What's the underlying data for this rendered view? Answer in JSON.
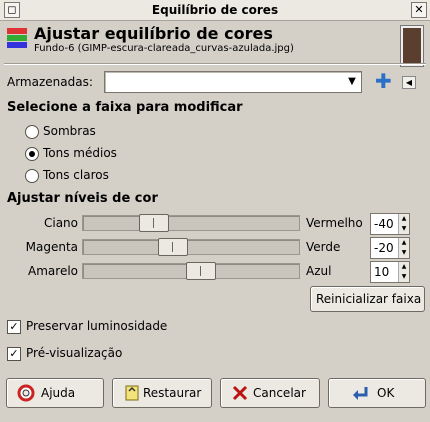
{
  "window": {
    "title": "Equilíbrio de cores"
  },
  "header": {
    "title": "Ajustar equilíbrio de cores",
    "subtitle": "Fundo-6 (GIMP-escura-clareada_curvas-azulada.jpg)"
  },
  "presets": {
    "label": "Armazenadas:",
    "value": ""
  },
  "range": {
    "heading": "Selecione a faixa para modificar",
    "options": [
      {
        "label": "Sombras",
        "selected": false
      },
      {
        "label": "Tons médios",
        "selected": true
      },
      {
        "label": "Tons claros",
        "selected": false
      }
    ]
  },
  "levels": {
    "heading": "Ajustar níveis de cor",
    "sliders": [
      {
        "left": "Ciano",
        "right": "Vermelho",
        "value": "-40",
        "level": -40
      },
      {
        "left": "Magenta",
        "right": "Verde",
        "value": "-20",
        "level": -20
      },
      {
        "left": "Amarelo",
        "right": "Azul",
        "value": "10",
        "level": 10
      }
    ],
    "range_min": -100,
    "range_max": 100,
    "reset_label": "Reinicializar faixa"
  },
  "options": {
    "preserve_luminosity": {
      "label": "Preservar luminosidade",
      "checked": true
    },
    "preview": {
      "label": "Pré-visualização",
      "checked": true
    }
  },
  "buttons": {
    "help": "Ajuda",
    "restore": "Restaurar",
    "cancel": "Cancelar",
    "ok": "OK"
  },
  "colors": {
    "accent": "#2a6fc8",
    "background": "#d4d0c8"
  }
}
